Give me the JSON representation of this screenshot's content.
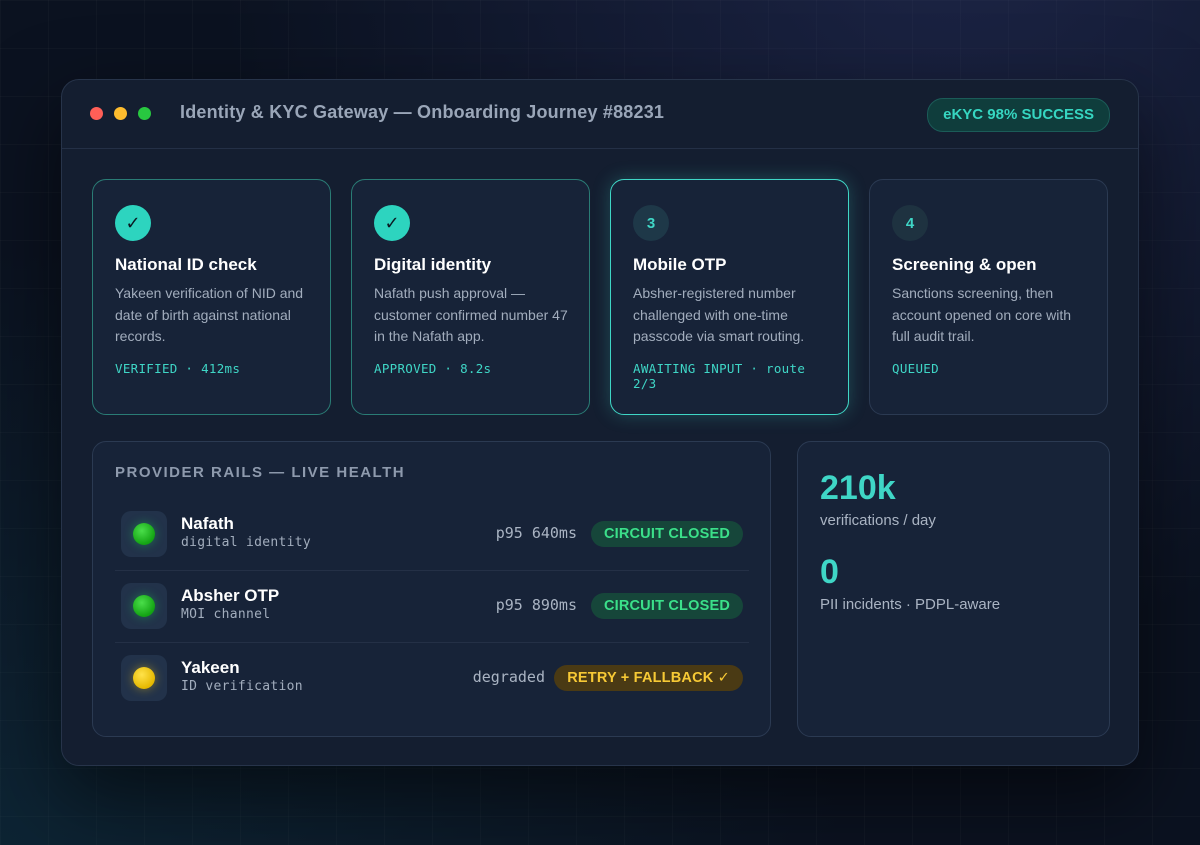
{
  "window": {
    "title": "Identity & KYC Gateway — Onboarding Journey #88231",
    "success_badge": "eKYC 98% SUCCESS"
  },
  "steps": [
    {
      "badge": "✓",
      "title": "National ID check",
      "description": "Yakeen verification of NID and date of birth against national records.",
      "status": "VERIFIED · 412ms",
      "state": "done"
    },
    {
      "badge": "✓",
      "title": "Digital identity",
      "description": "Nafath push approval — customer confirmed number 47 in the Nafath app.",
      "status": "APPROVED · 8.2s",
      "state": "done"
    },
    {
      "badge": "3",
      "title": "Mobile OTP",
      "description": "Absher-registered number challenged with one-time passcode via smart routing.",
      "status": "AWAITING INPUT · route 2/3",
      "state": "active"
    },
    {
      "badge": "4",
      "title": "Screening & open",
      "description": "Sanctions screening, then account opened on core with full audit trail.",
      "status": "QUEUED",
      "state": "queued"
    }
  ],
  "rails": {
    "heading": "PROVIDER RAILS — LIVE HEALTH",
    "items": [
      {
        "name": "Nafath",
        "subtitle": "digital identity",
        "metric": "p95 640ms",
        "pill": "CIRCUIT CLOSED",
        "light": "green",
        "pill_color": "#3be08a"
      },
      {
        "name": "Absher OTP",
        "subtitle": "MOI channel",
        "metric": "p95 890ms",
        "pill": "CIRCUIT CLOSED",
        "light": "green",
        "pill_color": "#3be08a"
      },
      {
        "name": "Yakeen",
        "subtitle": "ID verification",
        "metric": "degraded",
        "pill": "RETRY + FALLBACK ✓",
        "light": "yellow",
        "pill_color": "#f7c935"
      }
    ]
  },
  "stats": [
    {
      "value": "210k",
      "label": "verifications / day"
    },
    {
      "value": "0",
      "label": "PII incidents · PDPL-aware"
    }
  ],
  "colors": {
    "accent": "#3fd6c6",
    "ok": "#3be08a",
    "warn": "#f7c935",
    "panel": "#172338"
  }
}
